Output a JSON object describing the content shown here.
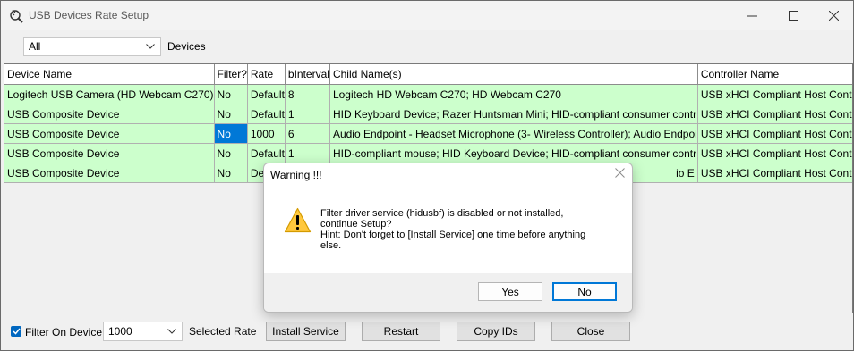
{
  "window": {
    "title": "USB Devices Rate Setup",
    "caption": {
      "minimize": "–",
      "maximize": "□",
      "close": "✕"
    }
  },
  "topbar": {
    "filter_select": {
      "value": "All"
    },
    "devices_label": "Devices"
  },
  "table": {
    "columns": [
      "Device Name",
      "Filter?",
      "Rate",
      "bInterval",
      "Child Name(s)",
      "Controller Name"
    ],
    "rows": [
      [
        "Logitech USB Camera (HD Webcam C270)",
        "No",
        "Default",
        "8",
        "Logitech HD Webcam C270; HD Webcam C270",
        "USB xHCI Compliant Host Controller - Intel(R) US"
      ],
      [
        "USB Composite Device",
        "No",
        "Default",
        "1",
        "HID Keyboard Device; Razer Huntsman Mini; HID-compliant consumer contr",
        "USB xHCI Compliant Host Controller - Intel(R) US"
      ],
      [
        "USB Composite Device",
        "No",
        "1000",
        "6",
        "Audio Endpoint - Headset Microphone (3- Wireless Controller); Audio Endpoi",
        "USB xHCI Compliant Host Controller - Intel(R) US"
      ],
      [
        "USB Composite Device",
        "No",
        "Default",
        "1",
        "HID-compliant mouse; HID Keyboard Device; HID-compliant consumer contr",
        "USB xHCI Compliant Host Controller - Intel(R) US"
      ],
      [
        "USB Composite Device",
        "No",
        "Defa",
        "",
        "io E",
        "USB xHCI Compliant Host Controller - Intel(R) US"
      ]
    ],
    "row_color": "#ccffcc",
    "selected_cell_color": "#0078d7"
  },
  "bottombar": {
    "filter_on_device_label": "Filter On Device",
    "filter_on_device_checked": true,
    "rate_select": {
      "value": "1000"
    },
    "selected_rate_label": "Selected Rate",
    "install_service_label": "Install Service",
    "restart_label": "Restart",
    "copy_ids_label": "Copy IDs",
    "close_label": "Close"
  },
  "dialog": {
    "title": "Warning !!!",
    "message": "Filter driver service (hidusbf) is disabled or not installed,\ncontinue Setup?\nHint: Don't forget to [Install Service] one time before anything\nelse.",
    "yes_label": "Yes",
    "no_label": "No",
    "icon": "warning-icon"
  }
}
